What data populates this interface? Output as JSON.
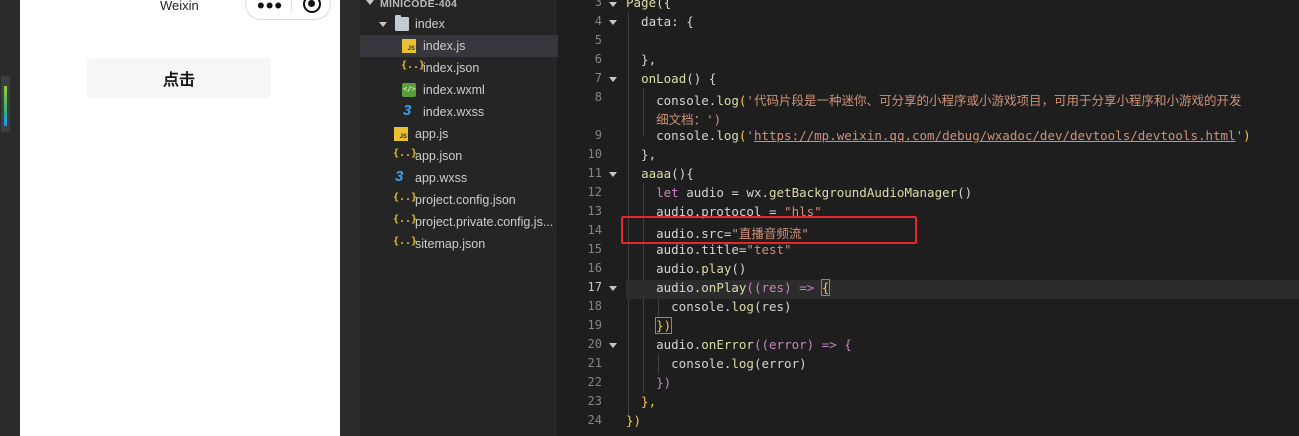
{
  "simulator": {
    "nav_title": "Weixin",
    "capsule_more": "•••",
    "tap_button_label": "点击"
  },
  "explorer": {
    "project_name": "MINICODE-404",
    "folder": "index",
    "items": [
      {
        "label": "index.js",
        "icon": "js-file-icon",
        "selected": true
      },
      {
        "label": "index.json",
        "icon": "json-file-icon"
      },
      {
        "label": "index.wxml",
        "icon": "wxml-file-icon"
      },
      {
        "label": "index.wxss",
        "icon": "wxss-file-icon"
      },
      {
        "label": "app.js",
        "icon": "js-file-icon"
      },
      {
        "label": "app.json",
        "icon": "json-file-icon"
      },
      {
        "label": "app.wxss",
        "icon": "wxss-file-icon"
      },
      {
        "label": "project.config.json",
        "icon": "json-file-icon"
      },
      {
        "label": "project.private.config.js...",
        "icon": "json-file-icon"
      },
      {
        "label": "sitemap.json",
        "icon": "json-file-icon"
      }
    ]
  },
  "editor": {
    "active_line": "17",
    "line_numbers": [
      "3",
      "4",
      "5",
      "6",
      "7",
      "8",
      "",
      "9",
      "10",
      "11",
      "12",
      "13",
      "14",
      "15",
      "16",
      "17",
      "18",
      "19",
      "20",
      "21",
      "22",
      "23",
      "24"
    ],
    "lines": {
      "l1": "Page({",
      "l2": "  data: {",
      "l3": "",
      "l4": "  },",
      "l5_fn": "onLoad",
      "l5_rest": "() {",
      "l6_a": "    console.",
      "l6_fn": "log",
      "l6_p": "(",
      "l6_s": "'代码片段是一种迷你、可分享的小程序或小游戏项目，可用于分享小程序和小游戏的开发",
      "l7_s": "    细文档：')",
      "l8_a": "    console.",
      "l8_fn": "log",
      "l8_p": "(",
      "l8_q1": "'",
      "l8_url": "https://mp.weixin.qq.com/debug/wxadoc/dev/devtools/devtools.html",
      "l8_q2": "'",
      "l8_end": ")",
      "l9": "  },",
      "l10_fn": "aaaa",
      "l10_rest": "(){",
      "l11_kw": "let",
      "l11_rest": " audio = wx.",
      "l11_fn": "getBackgroundAudioManager",
      "l11_end": "()",
      "l12_a": "    audio.protocol = ",
      "l12_s": "\"hls\"",
      "l13_a": "    audio.src=",
      "l13_s": "\"直播音频流\"",
      "l14_a": "    audio.title=",
      "l14_s": "\"test\"",
      "l15_a": "    audio.",
      "l15_fn": "play",
      "l15_end": "()",
      "l16_a": "    audio.",
      "l16_fn": "onPlay",
      "l16_p1": "((",
      "l16_arg": "res",
      "l16_p2": ") => ",
      "l16_b": "{",
      "l17_a": "      console.",
      "l17_fn": "log",
      "l17_end": "(res)",
      "l18": "})",
      "l19_a": "    audio.",
      "l19_fn": "onError",
      "l19_p1": "((",
      "l19_arg": "error",
      "l19_p2": ") => {",
      "l20_a": "      console.",
      "l20_fn": "log",
      "l20_end": "(error)",
      "l21": "    })",
      "l22": "  },",
      "l23": "})"
    }
  },
  "annotation": {
    "color": "#e8252b"
  }
}
